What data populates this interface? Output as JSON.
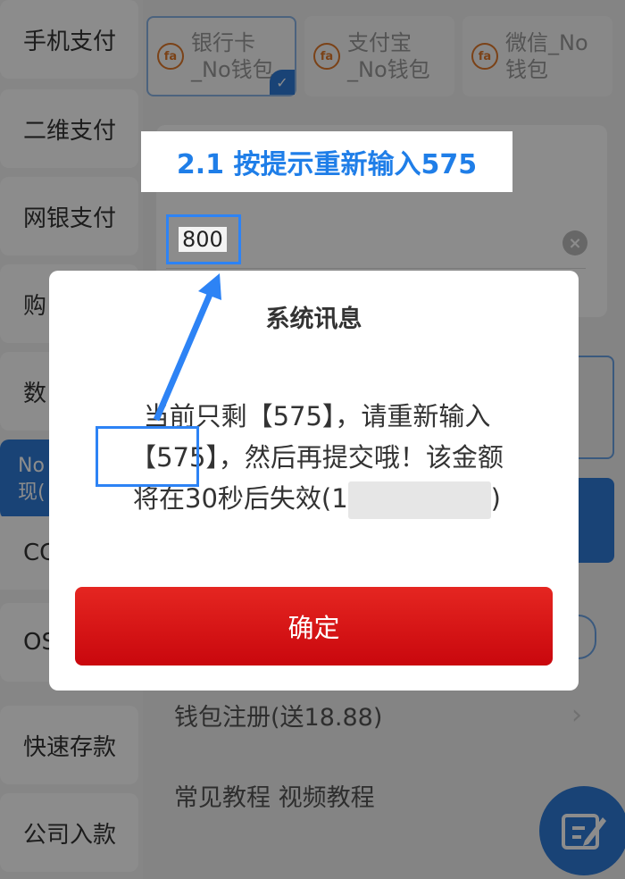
{
  "sidebar": {
    "items": [
      {
        "label": "手机支付"
      },
      {
        "label": "二维支付"
      },
      {
        "label": "网银支付"
      },
      {
        "label": "购"
      },
      {
        "label": "数"
      },
      {
        "label": "No\n现("
      },
      {
        "label": "CG"
      },
      {
        "label": "OS"
      },
      {
        "label": "快速存款"
      },
      {
        "label": "公司入款"
      }
    ]
  },
  "pay_tabs": [
    {
      "icon": "fa-logo-icon",
      "label": "银行卡\n_No钱包",
      "selected": true
    },
    {
      "icon": "fa-logo-icon",
      "label": "支付宝\n_No钱包",
      "selected": false
    },
    {
      "icon": "fa-logo-icon",
      "label": "微信_No\n钱包",
      "selected": false
    }
  ],
  "amount": {
    "value": "800"
  },
  "list_rows": [
    {
      "label": "钱包注册(送18.88)"
    },
    {
      "label": "常见教程 视频教程"
    }
  ],
  "annotation": {
    "label": "2.1 按提示重新输入575"
  },
  "dialog": {
    "title": "系统讯息",
    "message_line1": "当前只剩【575】，请重新输入",
    "message_line2_highlight": "【575】",
    "message_line2_rest": "，然后再提交哦！该金额",
    "message_line3_prefix": "将在30秒后失效(1",
    "message_line3_suffix": ")",
    "confirm_label": "确定"
  },
  "colors": {
    "accent_blue": "#2f7ad8",
    "annotation_blue": "#2d83f5",
    "confirm_red": "#d8131a"
  }
}
